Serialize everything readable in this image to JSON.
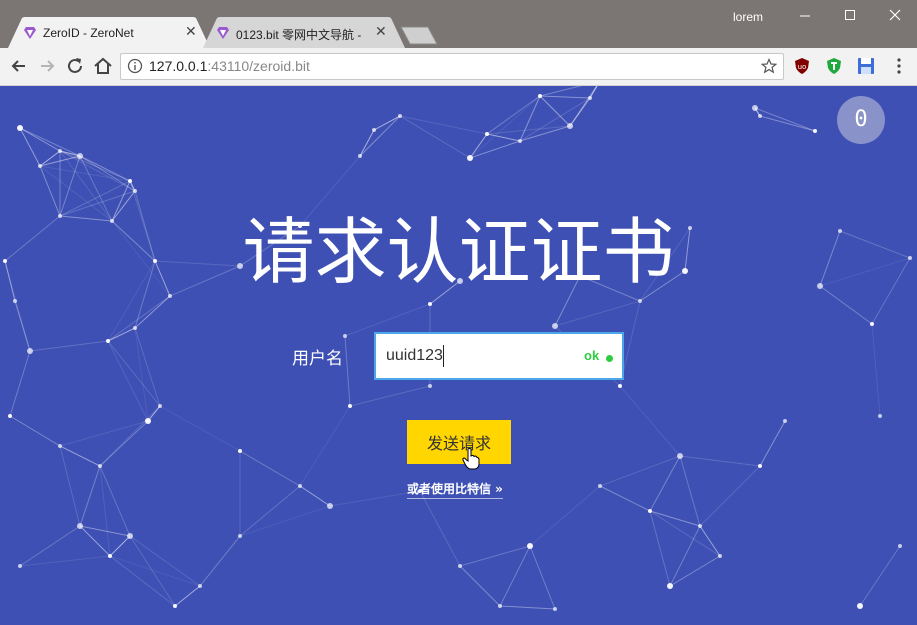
{
  "browser": {
    "tabs": [
      {
        "title": "ZeroID - ZeroNet",
        "active": true
      },
      {
        "title": "0123.bit 零网中文导航 -",
        "active": false
      }
    ],
    "profile_name": "lorem",
    "url_host": "127.0.0.1",
    "url_rest": ":43110/zeroid.bit",
    "tab_close_glyph": "✕"
  },
  "page": {
    "badge": "0",
    "title": "请求认证证书",
    "username_label": "用户名",
    "username_value": "uuid123",
    "status_text": "ok",
    "submit_label": "发送请求",
    "alt_link": "或者使用比特信 »"
  },
  "colors": {
    "page_background": "#3e50b4",
    "button": "#ffd600",
    "status_ok": "#2ecc40",
    "input_border": "#4aa8e8"
  }
}
